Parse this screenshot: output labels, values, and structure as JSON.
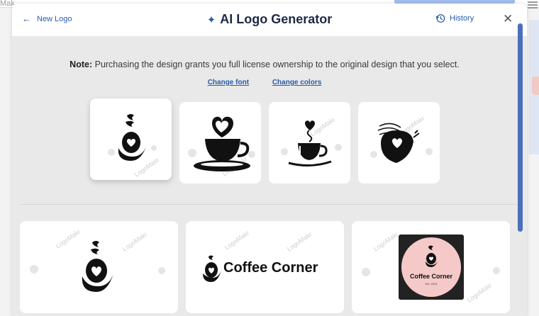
{
  "backdrop": {
    "left_text": "Mak"
  },
  "header": {
    "back_label": "New Logo",
    "title": "AI Logo Generator",
    "history_label": "History",
    "close_glyph": "✕"
  },
  "note": {
    "lead": "Note:",
    "text": "Purchasing the design grants you full license ownership to the original design that you select."
  },
  "links": {
    "change_font": "Change font",
    "change_colors": "Change colors"
  },
  "watermark": "LogoMakr",
  "icons": {
    "back": "arrow-left-icon",
    "title": "sparkle-icon",
    "history": "history-clock-icon",
    "close": "close-icon"
  },
  "colors": {
    "accent": "#2b5aa8",
    "modal_bg": "#e9e9e9",
    "scrollbar": "#4a6fbd",
    "badge_pink": "#f6c9c9",
    "badge_dark": "#222222"
  },
  "previews": {
    "brand_name": "Coffee Corner",
    "badge_name": "Coffee Corner",
    "badge_sub": "Est. 2024"
  }
}
